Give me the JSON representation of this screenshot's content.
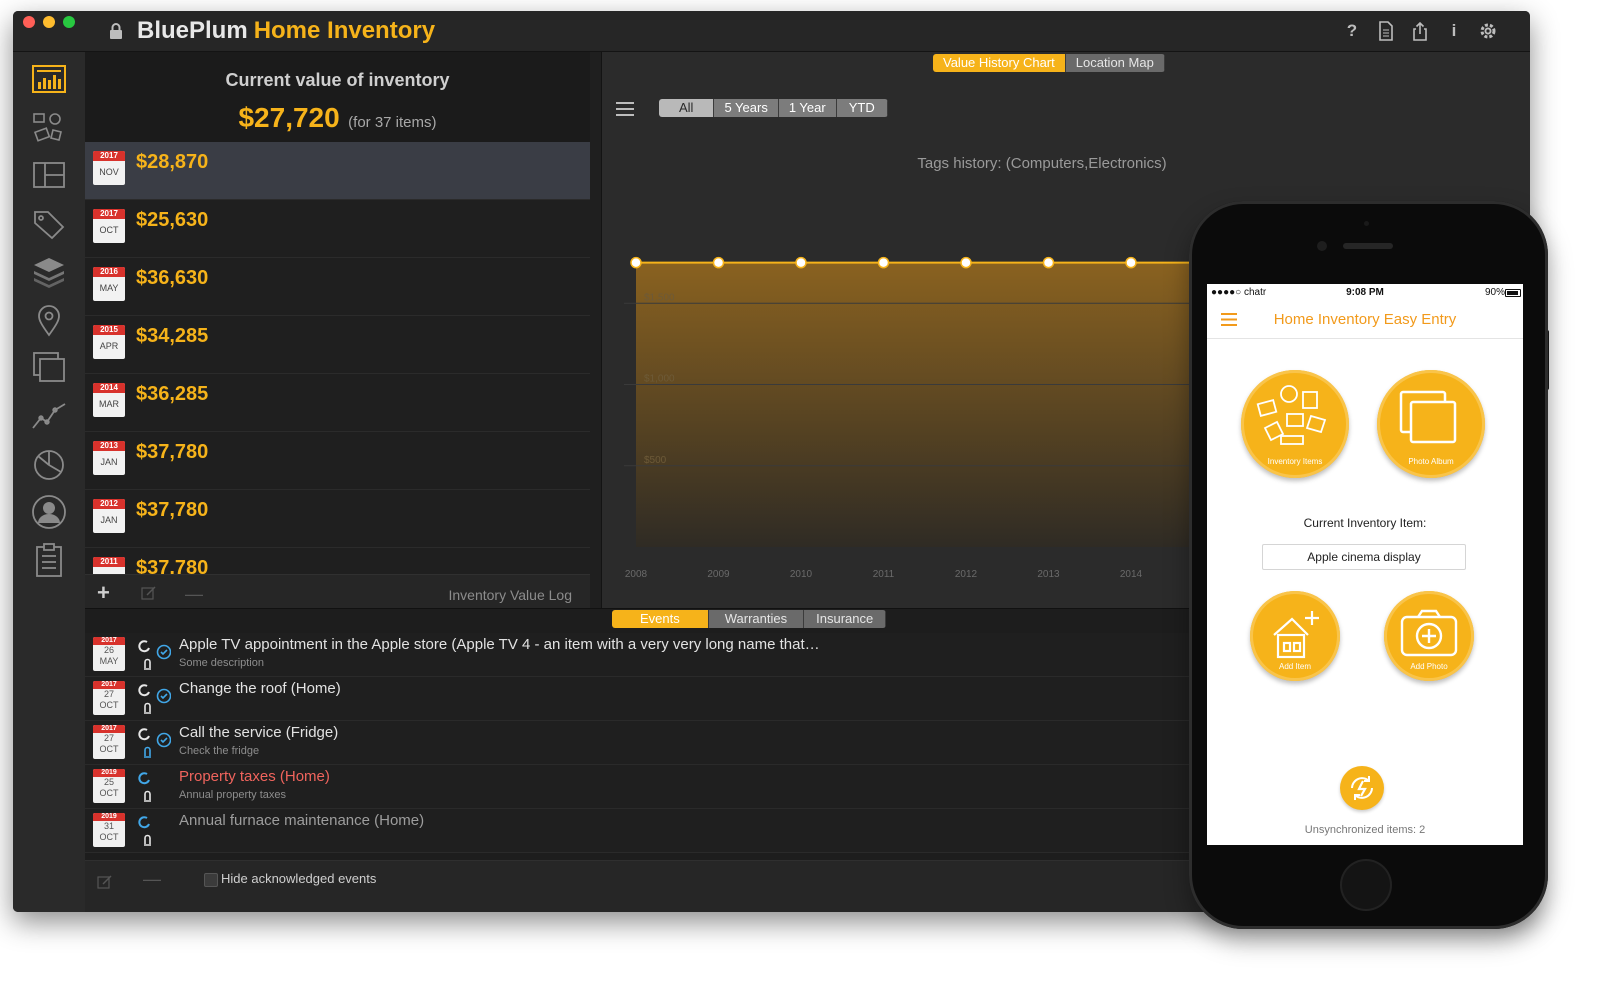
{
  "app": {
    "brand": "BluePlum",
    "name": "Home Inventory"
  },
  "toolbar_icons": [
    "help-icon",
    "document-icon",
    "share-icon",
    "info-icon",
    "gear-icon"
  ],
  "sidebar_icons": [
    "inventory-value-icon",
    "items-icon",
    "rooms-icon",
    "tags-icon",
    "layers-icon",
    "location-pin-icon",
    "photo-album-icon",
    "chart-line-icon",
    "pie-chart-icon",
    "user-icon",
    "clipboard-icon"
  ],
  "summary": {
    "title": "Current value of inventory",
    "value": "$27,720",
    "count": "(for 37 items)"
  },
  "log": [
    {
      "year": "2017",
      "month": "NOV",
      "value": "$28,870",
      "selected": true
    },
    {
      "year": "2017",
      "month": "OCT",
      "value": "$25,630"
    },
    {
      "year": "2016",
      "month": "MAY",
      "value": "$36,630"
    },
    {
      "year": "2015",
      "month": "APR",
      "value": "$34,285"
    },
    {
      "year": "2014",
      "month": "MAR",
      "value": "$36,285"
    },
    {
      "year": "2013",
      "month": "JAN",
      "value": "$37,780"
    },
    {
      "year": "2012",
      "month": "JAN",
      "value": "$37,780"
    },
    {
      "year": "2011",
      "month": "",
      "value": "$37,780"
    }
  ],
  "log_footer": {
    "label": "Inventory Value Log"
  },
  "chart_tabs": [
    "Value History Chart",
    "Location Map"
  ],
  "range_tabs": [
    "All",
    "5 Years",
    "1 Year",
    "YTD"
  ],
  "chart_data": {
    "type": "area",
    "title": "Tags history: (Computers,Electronics)",
    "categories": [
      "2008",
      "2009",
      "2010",
      "2011",
      "2012",
      "2013",
      "2014"
    ],
    "values": [
      1750,
      1750,
      1750,
      1750,
      1750,
      1750,
      1750
    ],
    "yticks": [
      "$1,500",
      "$1,000",
      "$500"
    ],
    "ylim": [
      0,
      2000
    ],
    "grid": true,
    "color": "#f6b31a"
  },
  "event_tabs": [
    "Events",
    "Warranties",
    "Insurance"
  ],
  "events": [
    {
      "year": "2017",
      "day": "26",
      "month": "MAY",
      "title": "Apple TV appointment in the Apple store (Apple TV  4 - an item with a very very long name that…",
      "desc": "Some description",
      "style": "normal",
      "acknowledged": true
    },
    {
      "year": "2017",
      "day": "27",
      "month": "OCT",
      "title": "Change the roof (Home)",
      "desc": "",
      "style": "normal",
      "acknowledged": true
    },
    {
      "year": "2017",
      "day": "27",
      "month": "OCT",
      "title": "Call the service (Fridge)",
      "desc": "Check the fridge",
      "style": "normal",
      "acknowledged": true
    },
    {
      "year": "2019",
      "day": "25",
      "month": "OCT",
      "title": "Property taxes (Home)",
      "desc": "Annual property taxes",
      "style": "red",
      "acknowledged": false
    },
    {
      "year": "2019",
      "day": "31",
      "month": "OCT",
      "title": "Annual furnace maintenance (Home)",
      "desc": "",
      "style": "dim",
      "acknowledged": false
    }
  ],
  "events_footer": {
    "checkbox_label": "Hide acknowledged events"
  },
  "phone": {
    "carrier": "●●●●○ chatr",
    "time": "9:08 PM",
    "battery": "90%",
    "title": "Home Inventory Easy Entry",
    "buttons": [
      {
        "label": "Inventory Items",
        "icon": "inventory-items-icon"
      },
      {
        "label": "Photo Album",
        "icon": "photo-album-icon"
      },
      {
        "label": "Add Item",
        "icon": "add-item-icon"
      },
      {
        "label": "Add Photo",
        "icon": "add-photo-icon"
      }
    ],
    "current_label": "Current Inventory Item:",
    "current_value": "Apple cinema display",
    "sync_label": "Unsynchronized items: 2"
  }
}
